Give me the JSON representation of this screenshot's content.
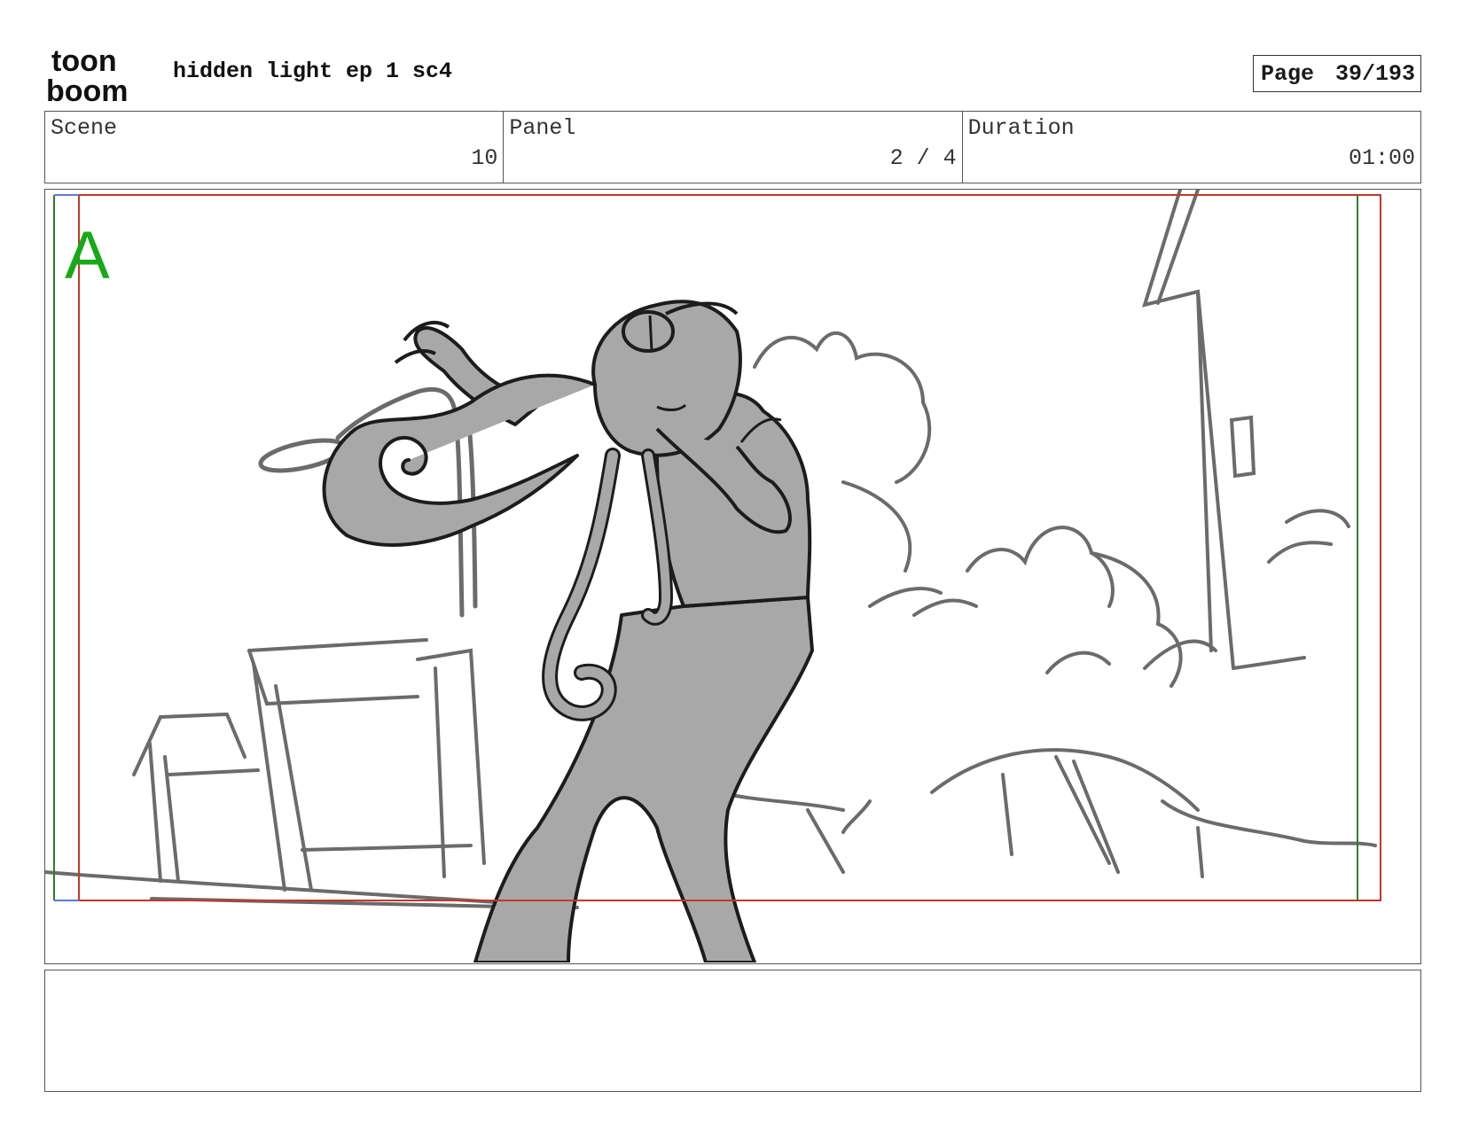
{
  "header": {
    "logo_top": "toon",
    "logo_bottom": "boom",
    "title": "hidden light ep 1 sc4",
    "page_label": "Page",
    "page_value": "39/193"
  },
  "info": {
    "scene_label": "Scene",
    "scene_value": "10",
    "panel_label": "Panel",
    "panel_value": "2 / 4",
    "duration_label": "Duration",
    "duration_value": "01:00"
  },
  "panel": {
    "layer_marker": "A",
    "colors": {
      "safe_frame": "#c0392b",
      "title_safe": "#2e7d32",
      "marker": "#18a818",
      "character_fill": "#a8a8a8",
      "sketch_line": "#6b6b6b",
      "ink_line": "#1c1c1c"
    }
  },
  "notes": {
    "text": ""
  }
}
